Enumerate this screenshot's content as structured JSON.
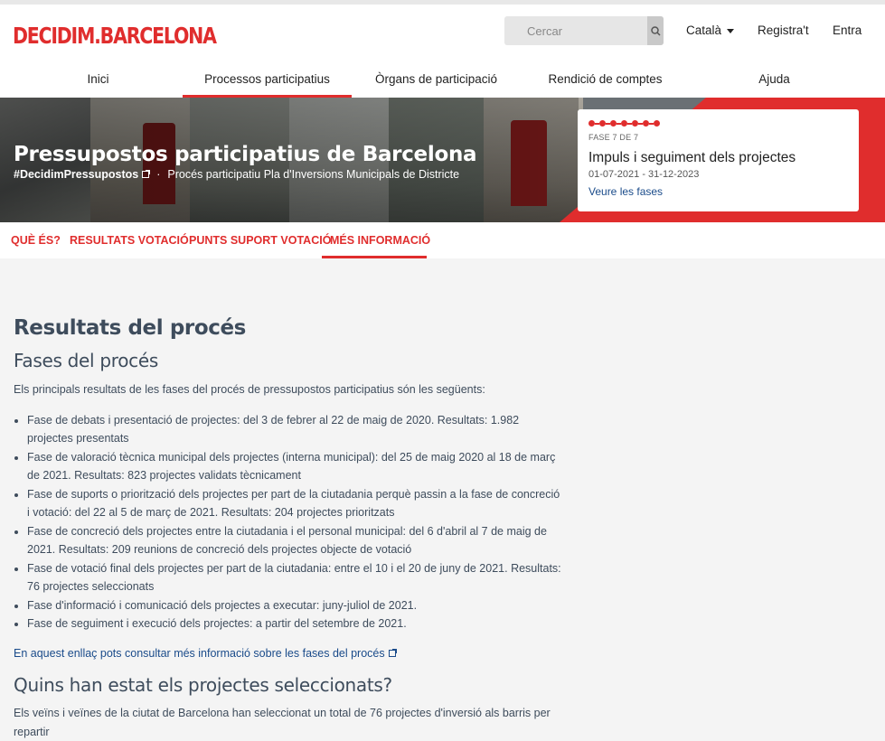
{
  "logo": "DECIDIM.BARCELONA",
  "search": {
    "placeholder": "Cercar"
  },
  "topbar": {
    "language": "Català",
    "register": "Registra't",
    "login": "Entra"
  },
  "main_nav": [
    "Inici",
    "Processos participatius",
    "Òrgans de participació",
    "Rendició de comptes",
    "Ajuda"
  ],
  "hero": {
    "title": "Pressupostos participatius de Barcelona",
    "hashtag": "#DecidimPressupostos",
    "subtitle": "Procés participatiu Pla d'Inversions Municipals de Districte"
  },
  "phase": {
    "step": "FASE 7 DE 7",
    "name": "Impuls i seguiment dels projectes",
    "dates": "01-07-2021 - 31-12-2023",
    "link": "Veure les fases"
  },
  "sub_nav": [
    "QUÈ ÉS?",
    "RESULTATS VOTACIÓ",
    "PUNTS SUPORT VOTACIÓ",
    "MÉS INFORMACIÓ"
  ],
  "content": {
    "heading": "Resultats del procés",
    "section1_title": "Fases del procés",
    "intro": "Els principals resultats de les fases del procés de pressupostos participatius són les següents:",
    "phases": [
      "Fase de debats i presentació de projectes: del 3 de febrer al 22 de maig de 2020. Resultats: 1.982 projectes presentats",
      "Fase de valoració tècnica municipal dels projectes (interna municipal): del 25 de maig 2020 al 18 de març de 2021. Resultats: 823 projectes validats tècnicament",
      "Fase de suports o priorització dels projectes per part de la ciutadania perquè passin a la fase de concreció i votació: del 22 al 5 de març de 2021. Resultats: 204 projectes prioritzats",
      "Fase de concreció dels projectes entre la ciutadania i el personal municipal: del 6 d'abril al 7 de maig de 2021. Resultats: 209 reunions de concreció dels projectes objecte de votació",
      "Fase de votació final dels projectes per part de la ciutadania: entre el 10 i el 20 de juny de 2021. Resultats: 76 projectes seleccionats",
      "Fase d'informació i comunicació dels projectes a executar: juny-juliol de 2021.",
      "Fase de seguiment i execució dels projectes: a partir del setembre de 2021."
    ],
    "more_link": "En aquest enllaç pots consultar més informació sobre les fases del procés",
    "section2_title": "Quins han estat els projectes seleccionats?",
    "section2_text": "Els veïns i veïnes de la ciutat de Barcelona han seleccionat un total de 76 projectes d'inversió als barris per repartir"
  },
  "colors": {
    "brand_red": "#e02d2d",
    "link_blue": "#1a4b8a",
    "text": "#3e4c5c"
  }
}
